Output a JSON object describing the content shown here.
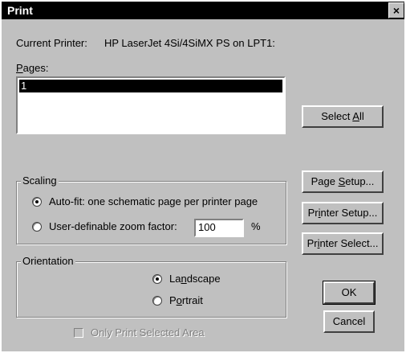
{
  "window": {
    "title": "Print",
    "close_glyph": "×"
  },
  "printer": {
    "label": "Current Printer:",
    "value": "HP LaserJet 4Si/4SiMX PS on LPT1:"
  },
  "pages": {
    "label": "Pages:",
    "items": [
      "1"
    ],
    "selected": "1"
  },
  "buttons": {
    "select_all": "Select All",
    "page_setup": "Page Setup...",
    "printer_setup": "Printer Setup...",
    "printer_select": "Printer Select...",
    "ok": "OK",
    "cancel": "Cancel"
  },
  "scaling": {
    "title": "Scaling",
    "auto_fit": "Auto-fit:  one schematic page per printer page",
    "user_zoom": "User-definable zoom factor:",
    "zoom_value": "100",
    "zoom_unit": "%",
    "selected": "auto_fit"
  },
  "orientation": {
    "title": "Orientation",
    "landscape": "Landscape",
    "portrait": "Portrait",
    "selected": "landscape"
  },
  "only_selected": {
    "label": "Only Print Selected Area",
    "checked": false,
    "enabled": false
  }
}
